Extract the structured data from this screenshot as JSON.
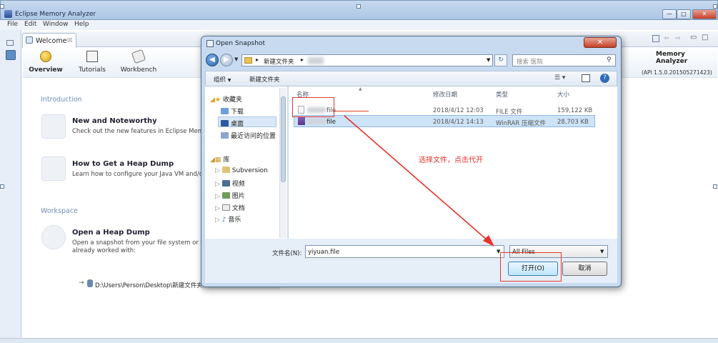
{
  "window": {
    "title": "Eclipse Memory Analyzer",
    "min": "—",
    "max": "□",
    "close": "✕"
  },
  "menu": [
    "File",
    "Edit",
    "Window",
    "Help"
  ],
  "tab": {
    "label": "Welcome",
    "close": "☒"
  },
  "header": {
    "nav": [
      "Overview",
      "Tutorials",
      "Workbench"
    ],
    "product": "Memory Analyzer",
    "api": "(API 1.5.0.201505271423)"
  },
  "content": {
    "intro_title": "Introduction",
    "items": [
      {
        "title": "New and Noteworthy",
        "desc": "Check out the new features in Eclipse Memor"
      },
      {
        "title": "How to Get a Heap Dump",
        "desc": "Learn how to configure your Java VM and/or E"
      }
    ],
    "workspace_title": "Workspace",
    "open_dump": {
      "title": "Open a Heap Dump",
      "desc1": "Open a snapshot from your file system or fro",
      "desc2": "already worked with:"
    },
    "recent_path": "D:\\Users\\Person\\Desktop\\新建文件夹"
  },
  "dialog": {
    "title": "Open Snapshot",
    "close": "✕",
    "address": "新建文件夹",
    "search_placeholder": "搜索 医院",
    "organize": "组织",
    "new_folder": "新建文件夹",
    "nav": {
      "favorites": "收藏夹",
      "fav_items": [
        "下载",
        "桌面",
        "最近访问的位置"
      ],
      "libraries": "库",
      "lib_items": [
        "Subversion",
        "视频",
        "图片",
        "文档",
        "音乐"
      ]
    },
    "columns": [
      "名称",
      "修改日期",
      "类型",
      "大小"
    ],
    "files": [
      {
        "name": "file",
        "date": "2018/4/12 12:03",
        "type": "FILE 文件",
        "size": "159,122 KB"
      },
      {
        "name": "file",
        "date": "2018/4/12 14:13",
        "type": "WinRAR 压缩文件",
        "size": "28,703 KB"
      }
    ],
    "filename_label": "文件名(N):",
    "filename_value": "yiyuan.file",
    "filter": "All Files",
    "open": "打开(O)",
    "cancel": "取消"
  },
  "annotation": "选择文件，点击代开",
  "colors": {
    "annotation": "#e8322a",
    "selection": "#cde3f7",
    "accent": "#6e8fb6"
  }
}
